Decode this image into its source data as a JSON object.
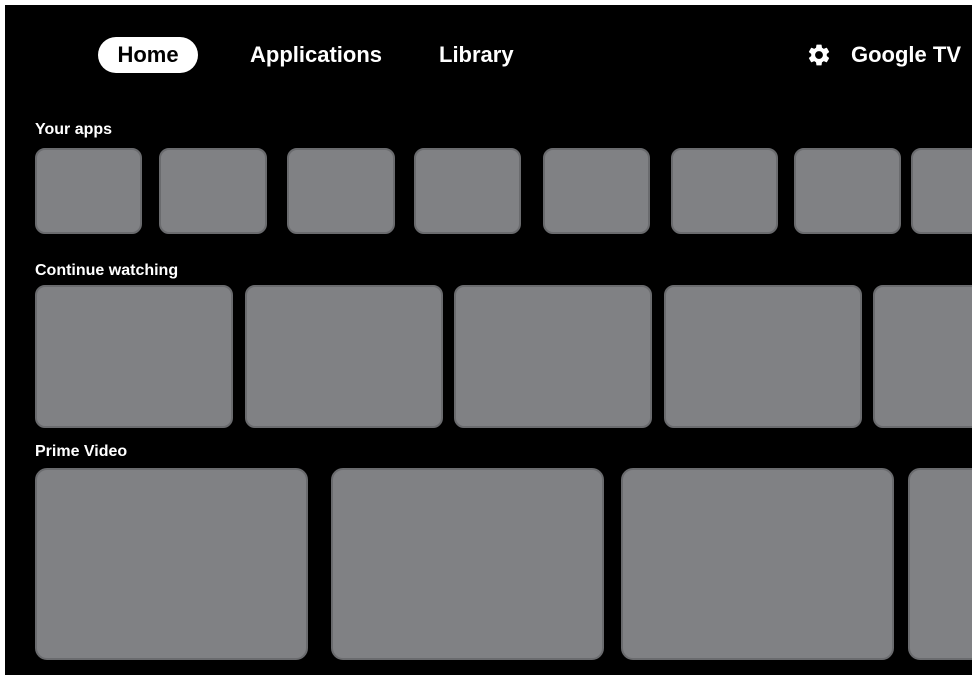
{
  "nav": {
    "tabs": [
      {
        "label": "Home",
        "active": true
      },
      {
        "label": "Applications",
        "active": false
      },
      {
        "label": "Library",
        "active": false
      }
    ],
    "settings_icon": "gear-icon",
    "brand": "Google TV"
  },
  "rows": {
    "your_apps": {
      "title": "Your apps"
    },
    "continue_watching": {
      "title": "Continue watching"
    },
    "prime_video": {
      "title": "Prime Video"
    }
  },
  "colors": {
    "background": "#000000",
    "card": "#808184",
    "active_tab_bg": "#ffffff",
    "text": "#ffffff"
  }
}
